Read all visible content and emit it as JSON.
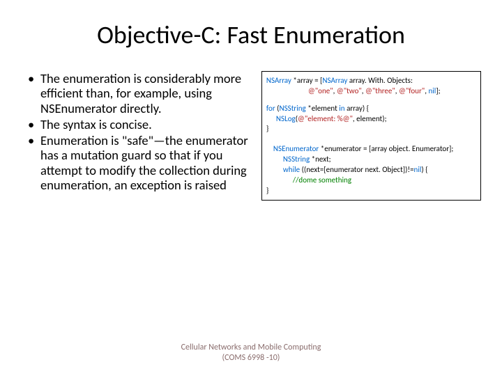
{
  "title": "Objective-C: Fast Enumeration",
  "bullets": [
    "The enumeration is considerably more efficient than, for example, using NSEnumerator directly.",
    "The syntax is concise.",
    "Enumeration is \"safe\"—the enumerator has a mutation guard so that if you attempt to modify the collection during enumeration, an exception is raised"
  ],
  "code": {
    "l1a": "NSArray",
    "l1b": " *array = [",
    "l1c": "NSArray",
    "l1d": " array. With. Objects:",
    "l2a": "@\"one\"",
    "l2b": ", ",
    "l2c": "@\"two\"",
    "l2d": ", ",
    "l2e": "@\"three\"",
    "l2f": ", ",
    "l2g": "@\"four\"",
    "l2h": ", ",
    "l2i": "nil",
    "l2j": "];",
    "l3a": "for",
    "l3b": " (",
    "l3c": "NSString",
    "l3d": " *element ",
    "l3e": "in",
    "l3f": " array) {",
    "l4a": "NSLog",
    "l4b": "(",
    "l4c": "@\"element: %@\"",
    "l4d": ", element);",
    "l5": "}",
    "l6a": "NSEnumerator",
    "l6b": " *enumerator = [array object. Enumerator];",
    "l7a": "NSString",
    "l7b": " *next;",
    "l8a": "while",
    "l8b": " ((next=[enumerator next. Object])!=",
    "l8c": "nil",
    "l8d": ") {",
    "l9": "//dome something",
    "l10": "}"
  },
  "footer1": "Cellular Networks and Mobile Computing",
  "footer2": "(COMS 6998 -10)"
}
